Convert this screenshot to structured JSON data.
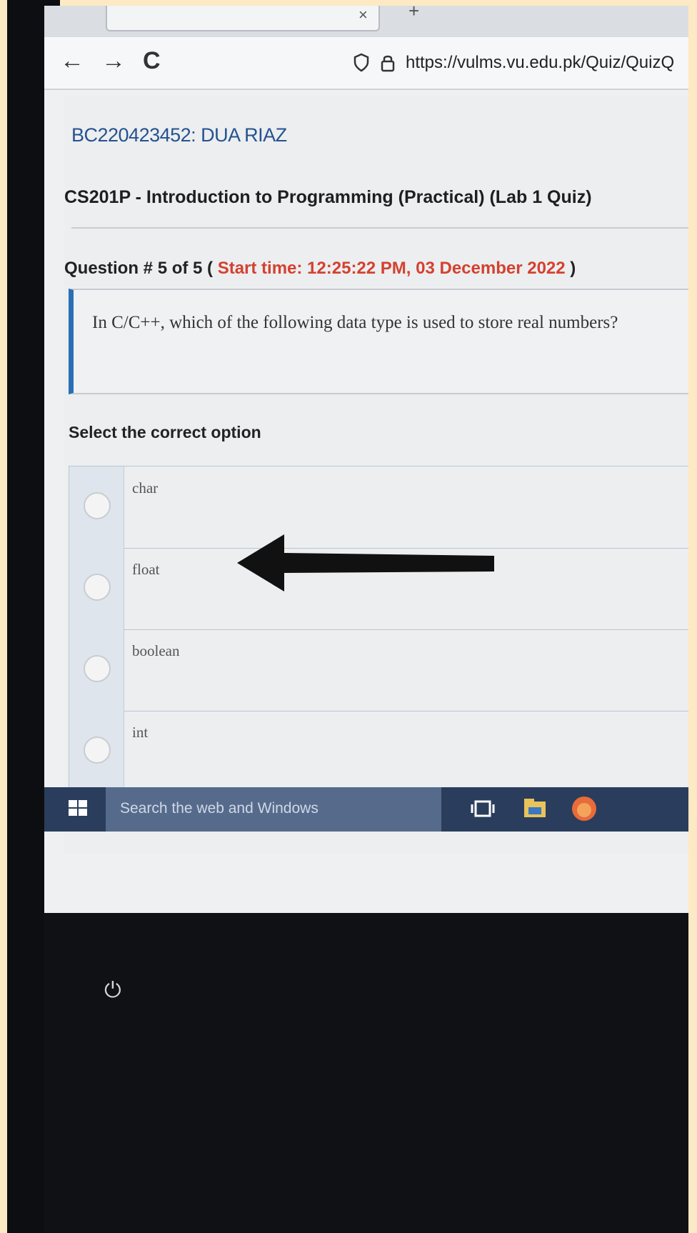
{
  "browser": {
    "url": "https://vulms.vu.edu.pk/Quiz/QuizQ",
    "back_icon": "←",
    "forward_icon": "→",
    "reload_icon": "C",
    "tab_close_icon": "×",
    "new_tab_icon": "+"
  },
  "page": {
    "student": "BC220423452: DUA RIAZ",
    "course": "CS201P - Introduction to Programming (Practical) (Lab 1 Quiz)",
    "question_prefix": "Question # 5 of 5 (",
    "start_time": "Start time: 12:25:22 PM, 03 December 2022",
    "question_suffix": ")",
    "question_text": "In C/C++, which of the following data type is used to store real numbers?",
    "select_label": "Select the correct option",
    "options": [
      {
        "label": "char"
      },
      {
        "label": "float"
      },
      {
        "label": "boolean"
      },
      {
        "label": "int"
      }
    ]
  },
  "taskbar": {
    "search_placeholder": "Search the web and Windows"
  },
  "colors": {
    "student": "#26528f",
    "start_time": "#d4412f",
    "question_border": "#2a6fb5"
  }
}
